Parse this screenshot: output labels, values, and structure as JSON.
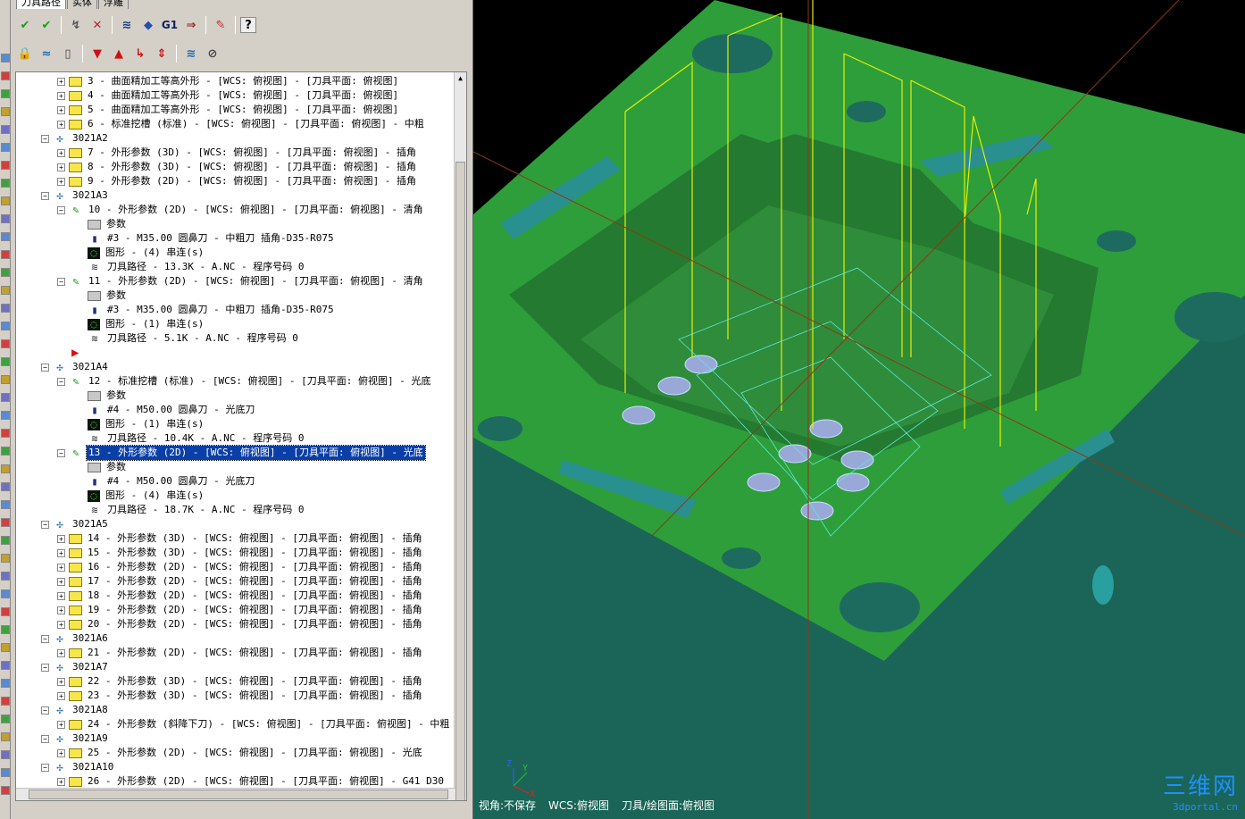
{
  "tabs": [
    "刀具路径",
    "实体",
    "浮雕"
  ],
  "tree": [
    {
      "kind": "op",
      "level": 0,
      "text": "3 - 曲面精加工等高外形 - [WCS: 俯视图] - [刀具平面: 俯视图]"
    },
    {
      "kind": "op",
      "level": 0,
      "text": "4 - 曲面精加工等高外形 - [WCS: 俯视图] - [刀具平面: 俯视图]"
    },
    {
      "kind": "op",
      "level": 0,
      "text": "5 - 曲面精加工等高外形 - [WCS: 俯视图] - [刀具平面: 俯视图]"
    },
    {
      "kind": "op",
      "level": 0,
      "text": "6 - 标准挖槽 (标准) - [WCS: 俯视图] - [刀具平面: 俯视图] - 中粗"
    },
    {
      "kind": "grp",
      "text": "3021A2"
    },
    {
      "kind": "op",
      "level": 0,
      "text": "7 - 外形参数 (3D) - [WCS: 俯视图] - [刀具平面: 俯视图] - 插角"
    },
    {
      "kind": "op",
      "level": 0,
      "text": "8 - 外形参数 (3D) - [WCS: 俯视图] - [刀具平面: 俯视图] - 插角"
    },
    {
      "kind": "op",
      "level": 0,
      "text": "9 - 外形参数 (2D) - [WCS: 俯视图] - [刀具平面: 俯视图] - 插角"
    },
    {
      "kind": "grp",
      "text": "3021A3"
    },
    {
      "kind": "opx",
      "level": 0,
      "text": "10 - 外形参数 (2D) - [WCS: 俯视图] - [刀具平面: 俯视图] - 清角"
    },
    {
      "kind": "param",
      "text": "参数"
    },
    {
      "kind": "tool",
      "text": "#3 - M35.00 圆鼻刀 - 中粗刀 插角-D35-R075"
    },
    {
      "kind": "geo",
      "text": "图形 - (4) 串连(s)"
    },
    {
      "kind": "path",
      "text": "刀具路径 - 13.3K - A.NC - 程序号码 0"
    },
    {
      "kind": "opx",
      "level": 0,
      "text": "11 - 外形参数 (2D) - [WCS: 俯视图] - [刀具平面: 俯视图] - 清角"
    },
    {
      "kind": "param",
      "text": "参数"
    },
    {
      "kind": "tool",
      "text": "#3 - M35.00 圆鼻刀 - 中粗刀 插角-D35-R075"
    },
    {
      "kind": "geo",
      "text": "图形 - (1) 串连(s)"
    },
    {
      "kind": "path",
      "text": "刀具路径 - 5.1K - A.NC - 程序号码 0"
    },
    {
      "kind": "arrow",
      "text": ""
    },
    {
      "kind": "grp",
      "text": "3021A4"
    },
    {
      "kind": "opx",
      "level": 0,
      "text": "12 - 标准挖槽 (标准) - [WCS: 俯视图] - [刀具平面: 俯视图] - 光底"
    },
    {
      "kind": "param",
      "text": "参数"
    },
    {
      "kind": "tool",
      "text": "#4 - M50.00 圆鼻刀 - 光底刀"
    },
    {
      "kind": "geo",
      "text": "图形 - (1) 串连(s)"
    },
    {
      "kind": "path",
      "text": "刀具路径 - 10.4K - A.NC - 程序号码 0"
    },
    {
      "kind": "opx",
      "level": 0,
      "sel": true,
      "text": "13 - 外形参数 (2D) - [WCS: 俯视图] - [刀具平面: 俯视图] - 光底"
    },
    {
      "kind": "param",
      "text": "参数"
    },
    {
      "kind": "tool",
      "text": "#4 - M50.00 圆鼻刀 - 光底刀"
    },
    {
      "kind": "geo",
      "text": "图形 - (4) 串连(s)"
    },
    {
      "kind": "path",
      "text": "刀具路径 - 18.7K - A.NC - 程序号码 0"
    },
    {
      "kind": "grp",
      "text": "3021A5"
    },
    {
      "kind": "op",
      "level": 0,
      "text": "14 - 外形参数 (3D) - [WCS: 俯视图] - [刀具平面: 俯视图] - 插角"
    },
    {
      "kind": "op",
      "level": 0,
      "text": "15 - 外形参数 (3D) - [WCS: 俯视图] - [刀具平面: 俯视图] - 插角"
    },
    {
      "kind": "op",
      "level": 0,
      "text": "16 - 外形参数 (2D) - [WCS: 俯视图] - [刀具平面: 俯视图] - 插角"
    },
    {
      "kind": "op",
      "level": 0,
      "text": "17 - 外形参数 (2D) - [WCS: 俯视图] - [刀具平面: 俯视图] - 插角"
    },
    {
      "kind": "op",
      "level": 0,
      "text": "18 - 外形参数 (2D) - [WCS: 俯视图] - [刀具平面: 俯视图] - 插角"
    },
    {
      "kind": "op",
      "level": 0,
      "text": "19 - 外形参数 (2D) - [WCS: 俯视图] - [刀具平面: 俯视图] - 插角"
    },
    {
      "kind": "op",
      "level": 0,
      "text": "20 - 外形参数 (2D) - [WCS: 俯视图] - [刀具平面: 俯视图] - 插角"
    },
    {
      "kind": "grp",
      "text": "3021A6"
    },
    {
      "kind": "op",
      "level": 0,
      "text": "21 - 外形参数 (2D) - [WCS: 俯视图] - [刀具平面: 俯视图] - 插角"
    },
    {
      "kind": "grp",
      "text": "3021A7"
    },
    {
      "kind": "op",
      "level": 0,
      "text": "22 - 外形参数 (3D) - [WCS: 俯视图] - [刀具平面: 俯视图] - 插角"
    },
    {
      "kind": "op",
      "level": 0,
      "text": "23 - 外形参数 (3D) - [WCS: 俯视图] - [刀具平面: 俯视图] - 插角"
    },
    {
      "kind": "grp",
      "text": "3021A8"
    },
    {
      "kind": "op",
      "level": 0,
      "text": "24 - 外形参数 (斜降下刀) - [WCS: 俯视图] - [刀具平面: 俯视图] - 中粗"
    },
    {
      "kind": "grp",
      "text": "3021A9"
    },
    {
      "kind": "op",
      "level": 0,
      "text": "25 - 外形参数 (2D) - [WCS: 俯视图] - [刀具平面: 俯视图] - 光底"
    },
    {
      "kind": "grp",
      "text": "3021A10"
    },
    {
      "kind": "op",
      "level": 0,
      "text": "26 - 外形参数 (2D) - [WCS: 俯视图] - [刀具平面: 俯视图] - G41 D30"
    }
  ],
  "toolbar1": [
    "check-all-icon",
    "check-clean-icon",
    "regen-icon",
    "regen-clear-icon",
    "backplot-icon",
    "verify-icon",
    "G1",
    "post-icon",
    "rocket-icon",
    "help-icon"
  ],
  "g1_label": "G1",
  "help_label": "?",
  "status": {
    "view": "视角:不保存",
    "wcs": "WCS:俯视图",
    "plane": "刀具/绘图面:俯视图"
  },
  "axis": {
    "z": "Z",
    "y": "Y",
    "x": "X"
  },
  "watermark": {
    "title": "三维网",
    "url": "3dportal.cn"
  },
  "colors": {
    "top": "#2e9e3a",
    "side": "#1f6e62",
    "pocket": "#2a8a3a",
    "toolpath": "#e5f000",
    "selection": "#0a3fa8"
  }
}
